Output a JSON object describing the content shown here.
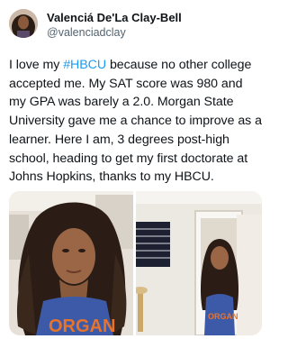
{
  "author": {
    "display_name": "Valenciá De'La Clay-Bell",
    "handle": "@valenciadclay",
    "avatar_icon": "profile-photo"
  },
  "tweet": {
    "part1": "I love my ",
    "hashtag": "#HBCU",
    "part2": " because no other college accepted me. My SAT score was 980 and my GPA was barely a 2.0. Morgan State University gave me a chance to improve as a learner. Here I am, 3 degrees post-high school, heading to get my first doctorate at Johns Hopkins, thanks to my HBCU."
  },
  "media": {
    "photo_left_shirt_text": "ORGAN",
    "photo_right_shirt_text": "ORGAN"
  },
  "colors": {
    "link": "#1d9bf0",
    "secondary_text": "#536471",
    "shirt_blue": "#3d5aa8",
    "shirt_orange": "#e8742a"
  }
}
